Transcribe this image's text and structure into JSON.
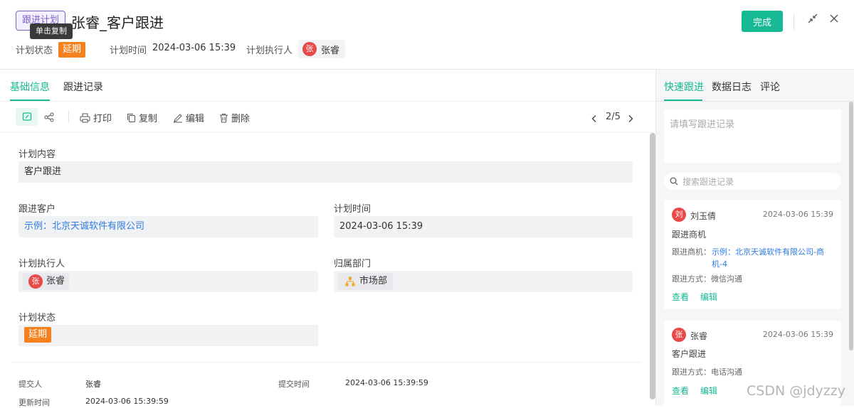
{
  "header": {
    "type_tag": "跟进计划",
    "tooltip": "单击复制",
    "title": "张睿_客户跟进",
    "status_label": "计划状态",
    "status_value": "延期",
    "time_label": "计划时间",
    "time_value": "2024-03-06 15:39",
    "executor_label": "计划执行人",
    "executor_avatar": "张",
    "executor_name": "张睿",
    "done_button": "完成"
  },
  "tabs": [
    "基础信息",
    "跟进记录"
  ],
  "toolbar": {
    "print": "打印",
    "copy": "复制",
    "edit": "编辑",
    "delete": "删除",
    "pager": "2/5"
  },
  "form": {
    "content_label": "计划内容",
    "content_value": "客户跟进",
    "customer_label": "跟进客户",
    "customer_value": "示例：北京天诚软件有限公司",
    "plan_time_label": "计划时间",
    "plan_time_value": "2024-03-06 15:39",
    "executor_label": "计划执行人",
    "executor_avatar": "张",
    "executor_value": "张睿",
    "dept_label": "归属部门",
    "dept_value": "市场部",
    "status_label": "计划状态",
    "status_value": "延期"
  },
  "footer": {
    "submitter_label": "提交人",
    "submitter_value": "张睿",
    "submit_time_label": "提交时间",
    "submit_time_value": "2024-03-06 15:39:59",
    "update_time_label": "更新时间",
    "update_time_value": "2024-03-06 15:39:59"
  },
  "right_panel": {
    "tabs": [
      "快速跟进",
      "数据日志",
      "评论"
    ],
    "input_placeholder": "请填写跟进记录",
    "search_placeholder": "搜索跟进记录",
    "cards": [
      {
        "avatar": "刘",
        "name": "刘玉倩",
        "time": "2024-03-06 15:39",
        "title": "跟进商机",
        "opp_label": "跟进商机：",
        "opp_value_line1": "示例：北京天诚软件有限公司-商",
        "opp_value_line2": "机-4",
        "method": "跟进方式：微信沟通",
        "view": "查看",
        "edit": "编辑"
      },
      {
        "avatar": "张",
        "name": "张睿",
        "time": "2024-03-06 15:39",
        "title": "客户跟进",
        "method": "跟进方式：电话沟通",
        "view": "查看",
        "edit": "编辑"
      }
    ]
  },
  "watermark": "CSDN @jdyzzy",
  "colors": {
    "accent": "#16b993",
    "status_orange": "#f5821f",
    "link_blue": "#2f7ae5",
    "avatar_red": "#e84a4a"
  }
}
